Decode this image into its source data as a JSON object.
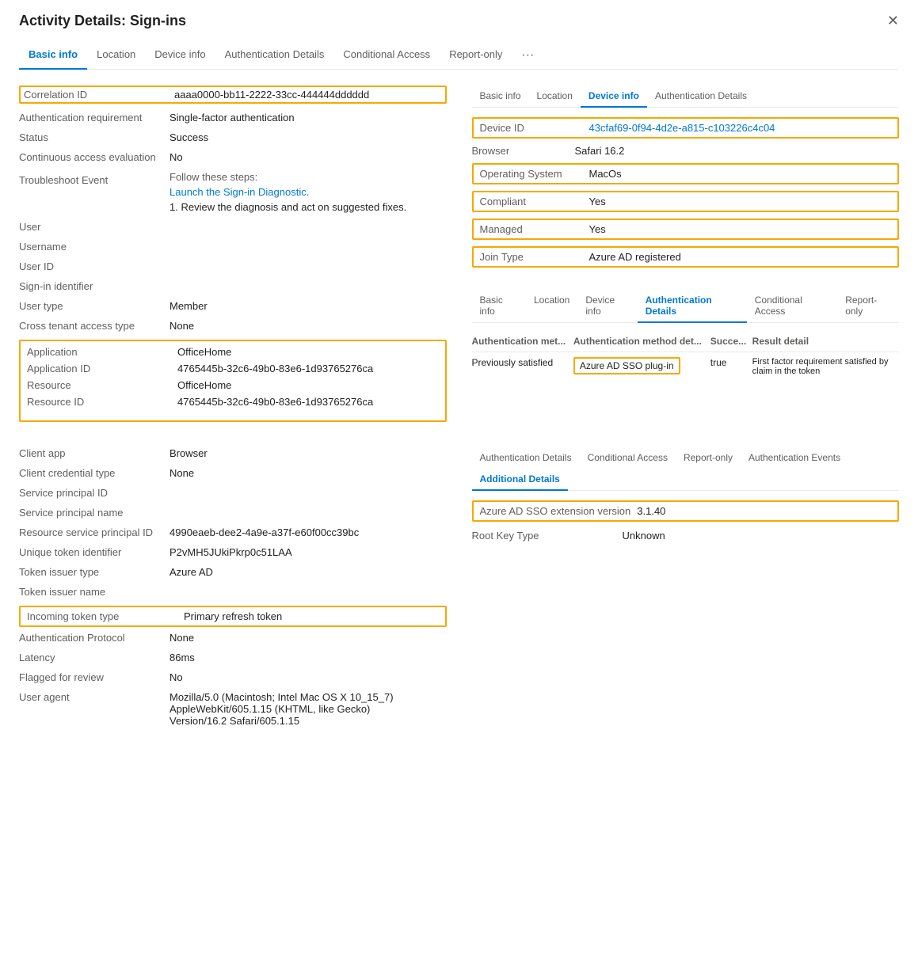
{
  "dialog": {
    "title": "Activity Details: Sign-ins"
  },
  "main_tabs": [
    {
      "label": "Basic info",
      "active": true
    },
    {
      "label": "Location",
      "active": false
    },
    {
      "label": "Device info",
      "active": false
    },
    {
      "label": "Authentication Details",
      "active": false
    },
    {
      "label": "Conditional Access",
      "active": false
    },
    {
      "label": "Report-only",
      "active": false
    }
  ],
  "fields": {
    "correlation_id_label": "Correlation ID",
    "correlation_id_value": "aaaa0000-bb11-2222-33cc-444444dddddd",
    "auth_req_label": "Authentication requirement",
    "auth_req_value": "Single-factor authentication",
    "status_label": "Status",
    "status_value": "Success",
    "cae_label": "Continuous access evaluation",
    "cae_value": "No",
    "troubleshoot_label": "Troubleshoot Event",
    "troubleshoot_follow": "Follow these steps:",
    "troubleshoot_link": "Launch the Sign-in Diagnostic.",
    "troubleshoot_step1": "1. Review the diagnosis and act on suggested fixes.",
    "user_label": "User",
    "user_value": "",
    "username_label": "Username",
    "username_value": "",
    "user_id_label": "User ID",
    "user_id_value": "",
    "signin_id_label": "Sign-in identifier",
    "signin_id_value": "",
    "user_type_label": "User type",
    "user_type_value": "Member",
    "cross_tenant_label": "Cross tenant access type",
    "cross_tenant_value": "None",
    "application_label": "Application",
    "application_value": "OfficeHome",
    "app_id_label": "Application ID",
    "app_id_value": "4765445b-32c6-49b0-83e6-1d93765276ca",
    "resource_label": "Resource",
    "resource_value": "OfficeHome",
    "resource_id_label": "Resource ID",
    "resource_id_value": "4765445b-32c6-49b0-83e6-1d93765276ca"
  },
  "device_panel": {
    "tabs": [
      {
        "label": "Basic info",
        "active": false
      },
      {
        "label": "Location",
        "active": false
      },
      {
        "label": "Device info",
        "active": true
      },
      {
        "label": "Authentication Details",
        "active": false
      }
    ],
    "device_id_label": "Device ID",
    "device_id_value": "43cfaf69-0f94-4d2e-a815-c103226c4c04",
    "browser_label": "Browser",
    "browser_value": "Safari 16.2",
    "os_label": "Operating System",
    "os_value": "MacOs",
    "compliant_label": "Compliant",
    "compliant_value": "Yes",
    "managed_label": "Managed",
    "managed_value": "Yes",
    "join_type_label": "Join Type",
    "join_type_value": "Azure AD registered"
  },
  "auth_details_panel": {
    "tabs": [
      {
        "label": "Basic info",
        "active": false
      },
      {
        "label": "Location",
        "active": false
      },
      {
        "label": "Device info",
        "active": false
      },
      {
        "label": "Authentication Details",
        "active": true
      },
      {
        "label": "Conditional Access",
        "active": false
      },
      {
        "label": "Report-only",
        "active": false
      }
    ],
    "table_headers": [
      "Authentication met...",
      "Authentication method det...",
      "Succe...",
      "Result detail"
    ],
    "rows": [
      {
        "auth_method": "Previously satisfied",
        "auth_method_detail": "Azure AD SSO plug-in",
        "success": "true",
        "result_detail": "First factor requirement satisfied by claim in the token"
      }
    ]
  },
  "bottom": {
    "client_app_label": "Client app",
    "client_app_value": "Browser",
    "client_cred_label": "Client credential type",
    "client_cred_value": "None",
    "sp_id_label": "Service principal ID",
    "sp_id_value": "",
    "sp_name_label": "Service principal name",
    "sp_name_value": "",
    "resource_sp_id_label": "Resource service principal ID",
    "resource_sp_id_value": "4990eaeb-dee2-4a9e-a37f-e60f00cc39bc",
    "unique_token_label": "Unique token identifier",
    "unique_token_value": "P2vMH5JUkiPkrp0c51LAA",
    "token_issuer_type_label": "Token issuer type",
    "token_issuer_type_value": "Azure AD",
    "token_issuer_name_label": "Token issuer name",
    "token_issuer_name_value": "",
    "incoming_token_label": "Incoming token type",
    "incoming_token_value": "Primary refresh token",
    "auth_protocol_label": "Authentication Protocol",
    "auth_protocol_value": "None",
    "latency_label": "Latency",
    "latency_value": "86ms",
    "flagged_label": "Flagged for review",
    "flagged_value": "No",
    "user_agent_label": "User agent",
    "user_agent_value": "Mozilla/5.0 (Macintosh; Intel Mac OS X 10_15_7) AppleWebKit/605.1.15 (KHTML, like Gecko) Version/16.2 Safari/605.1.15"
  },
  "additional_tabs": {
    "tabs": [
      {
        "label": "Authentication Details",
        "active": false
      },
      {
        "label": "Conditional Access",
        "active": false
      },
      {
        "label": "Report-only",
        "active": false
      },
      {
        "label": "Authentication Events",
        "active": false
      },
      {
        "label": "Additional Details",
        "active": true
      }
    ],
    "azure_sso_label": "Azure AD SSO extension version",
    "azure_sso_value": "3.1.40",
    "root_key_label": "Root Key Type",
    "root_key_value": "Unknown"
  }
}
